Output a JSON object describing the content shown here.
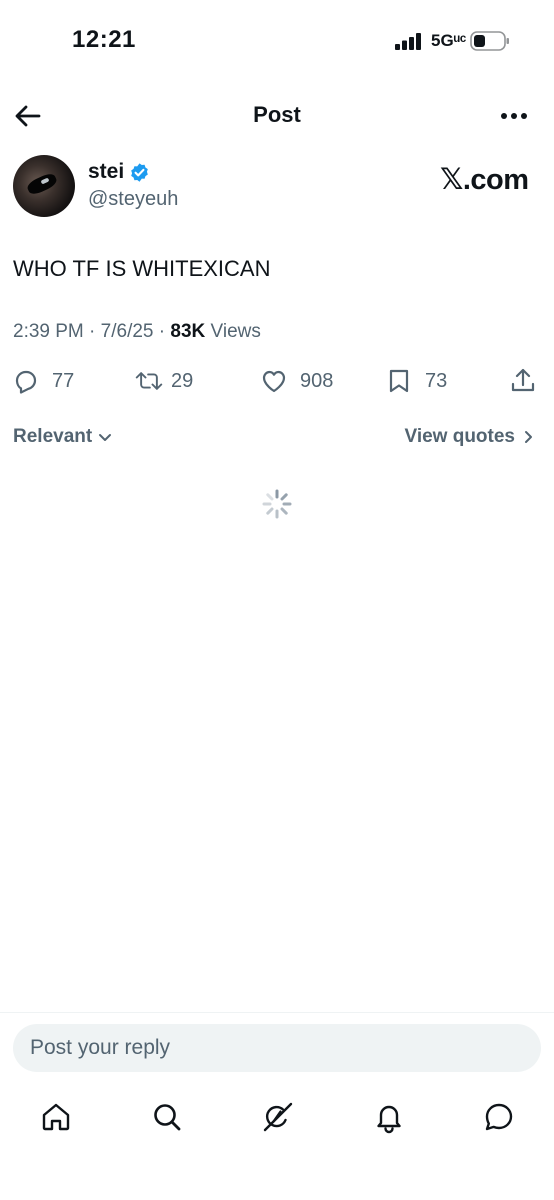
{
  "status_bar": {
    "time": "12:21",
    "network": "5Gᵘᶜ",
    "icons": [
      "signal-bars-icon",
      "battery-icon"
    ]
  },
  "header": {
    "title": "Post",
    "back_icon": "arrow-left-icon",
    "more_icon": "more-horizontal-icon"
  },
  "post": {
    "author_name": "stei",
    "author_handle": "@steyeuh",
    "verified": true,
    "watermark": "𝕏.com",
    "text": "WHO TF IS WHITEXICAN",
    "time": "2:39 PM",
    "date": "7/6/25",
    "views_count": "83K",
    "views_label": "Views",
    "meta_separator": "·"
  },
  "actions": {
    "replies": "77",
    "reposts": "29",
    "likes": "908",
    "bookmarks": "73"
  },
  "filter": {
    "sort_label": "Relevant",
    "quotes_label": "View quotes"
  },
  "reply": {
    "placeholder": "Post your reply"
  },
  "tab_bar": {
    "items": [
      "home-icon",
      "search-icon",
      "grok-icon",
      "notifications-icon",
      "messages-icon"
    ]
  },
  "colors": {
    "text_primary": "#0f1419",
    "text_secondary": "#536471",
    "verified_blue": "#1d9bf0",
    "input_bg": "#eff3f4"
  }
}
